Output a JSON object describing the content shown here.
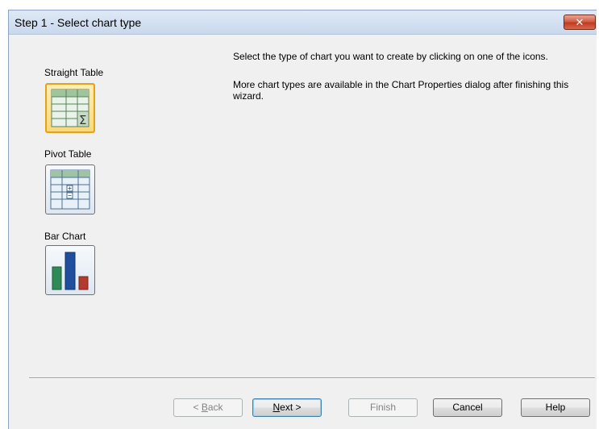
{
  "window": {
    "title": "Step 1 - Select chart type",
    "close_glyph": "✕"
  },
  "chart_types": [
    {
      "label": "Straight Table",
      "icon": "straight-table-icon",
      "selected": true
    },
    {
      "label": "Pivot Table",
      "icon": "pivot-table-icon",
      "selected": false
    },
    {
      "label": "Bar Chart",
      "icon": "bar-chart-icon",
      "selected": false
    }
  ],
  "instructions": {
    "line1": "Select the type of chart you want to create by clicking on one of the icons.",
    "line2": "More chart types are available in the Chart Properties dialog after finishing this wizard."
  },
  "buttons": {
    "back_prefix": "< ",
    "back_mnemonic": "B",
    "back_rest": "ack",
    "next_mnemonic": "N",
    "next_rest": "ext >",
    "finish": "Finish",
    "cancel": "Cancel",
    "help": "Help"
  },
  "colors": {
    "selected_border": "#e3a21a",
    "bar_green": "#2e8b57",
    "bar_blue": "#1f4e9c",
    "bar_red": "#b23a2e"
  }
}
